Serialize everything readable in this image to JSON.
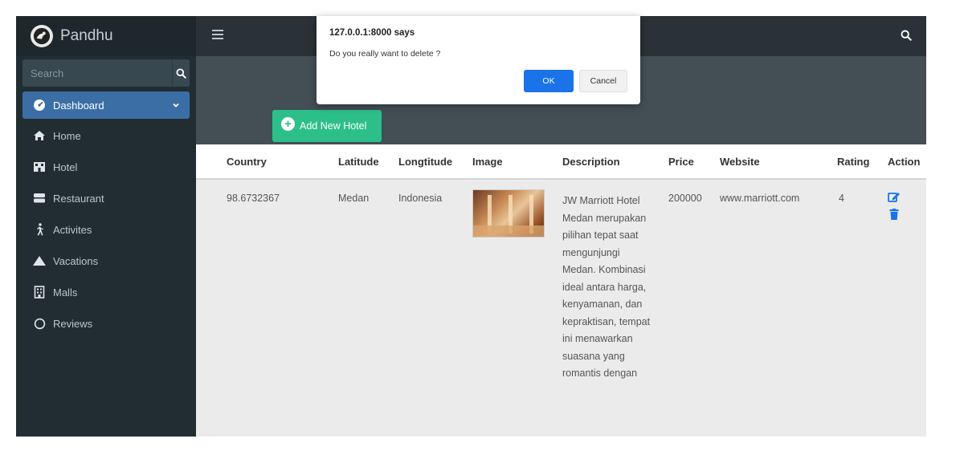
{
  "sidebar": {
    "brand": "Pandhu",
    "search_placeholder": "Search",
    "items": [
      {
        "label": "Dashboard",
        "icon": "dashboard-icon"
      },
      {
        "label": "Home",
        "icon": "home-icon"
      },
      {
        "label": "Hotel",
        "icon": "hotel-icon"
      },
      {
        "label": "Restaurant",
        "icon": "restaurant-icon"
      },
      {
        "label": "Activites",
        "icon": "walking-icon"
      },
      {
        "label": "Vacations",
        "icon": "mountain-icon"
      },
      {
        "label": "Malls",
        "icon": "building-icon"
      },
      {
        "label": "Reviews",
        "icon": "circle-icon"
      }
    ]
  },
  "toolbar": {
    "add_label": "Add New Hotel"
  },
  "table": {
    "columns": [
      "Country",
      "Latitude",
      "Longtitude",
      "Image",
      "Description",
      "Price",
      "Website",
      "Rating",
      "Action"
    ],
    "rows": [
      {
        "country": "98.6732367",
        "latitude": "Medan",
        "longitude": "Indonesia",
        "description": "JW Marriott Hotel Medan merupakan pilihan tepat saat mengunjungi Medan. Kombinasi ideal antara harga, kenyamanan, dan kepraktisan, tempat ini menawarkan suasana yang romantis dengan",
        "price": "200000",
        "website": "www.marriott.com",
        "rating": "4"
      }
    ]
  },
  "dialog": {
    "title": "127.0.0.1:8000 says",
    "message": "Do you really want to delete ?",
    "ok_label": "OK",
    "cancel_label": "Cancel"
  },
  "colors": {
    "sidebar_bg": "#222d32",
    "active_item": "#3c6ea6",
    "add_button": "#2dbf8a",
    "dialog_ok": "#1a73e8",
    "action_icons": "#1a73e8"
  }
}
